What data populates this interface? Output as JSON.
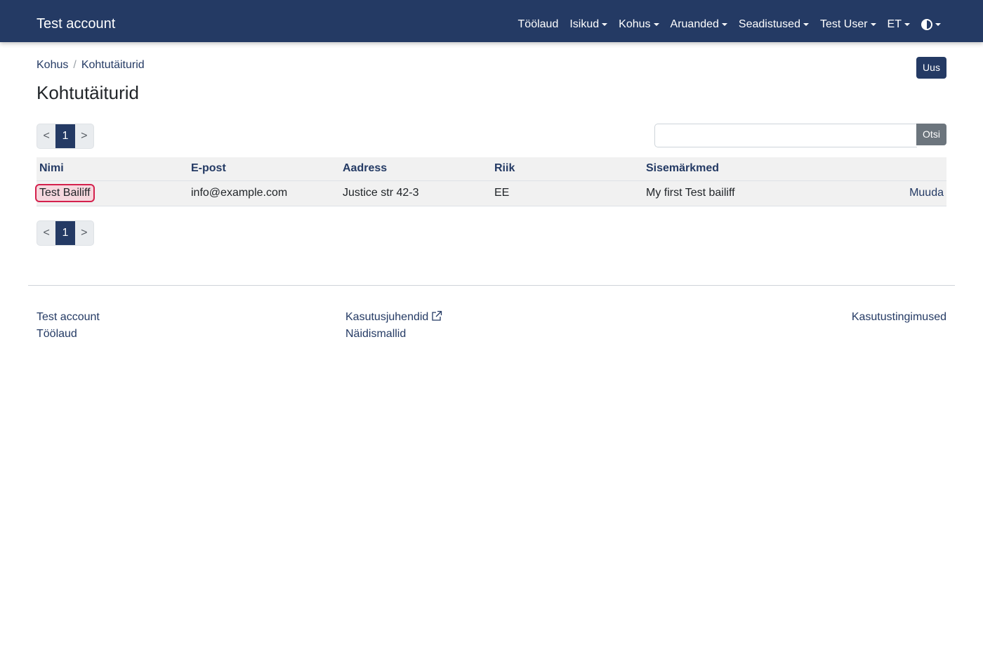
{
  "navbar": {
    "brand": "Test account",
    "items": [
      {
        "label": "Töölaud",
        "dropdown": false
      },
      {
        "label": "Isikud",
        "dropdown": true
      },
      {
        "label": "Kohus",
        "dropdown": true
      },
      {
        "label": "Aruanded",
        "dropdown": true
      },
      {
        "label": "Seadistused",
        "dropdown": true
      },
      {
        "label": "Test User",
        "dropdown": true
      },
      {
        "label": "ET",
        "dropdown": true
      }
    ],
    "theme_icon": "contrast-icon",
    "background": "#243a64"
  },
  "breadcrumb": [
    "Kohus",
    "Kohtutäiturid"
  ],
  "actions": {
    "new_label": "Uus"
  },
  "page": {
    "title": "Kohtutäiturid"
  },
  "pagination": {
    "prev": "<",
    "current": "1",
    "next": ">"
  },
  "search": {
    "placeholder": "",
    "value": "",
    "button_label": "Otsi"
  },
  "table": {
    "columns": [
      "Nimi",
      "E-post",
      "Aadress",
      "Riik",
      "Sisemärkmed",
      ""
    ],
    "rows": [
      {
        "name": "Test Bailiff",
        "email": "info@example.com",
        "address": "Justice str 42-3",
        "country": "EE",
        "notes": "My first Test bailiff",
        "edit": "Muuda"
      }
    ]
  },
  "footer": {
    "col1": [
      "Test account",
      "Töölaud"
    ],
    "col2": [
      "Kasutusjuhendid",
      "Näidismallid"
    ],
    "col2_external_icon": "external-link-icon",
    "col3": [
      "Kasutustingimused"
    ]
  },
  "colors": {
    "primary": "#243a64",
    "secondary": "#6c757d",
    "highlight_border": "#d4204c"
  }
}
